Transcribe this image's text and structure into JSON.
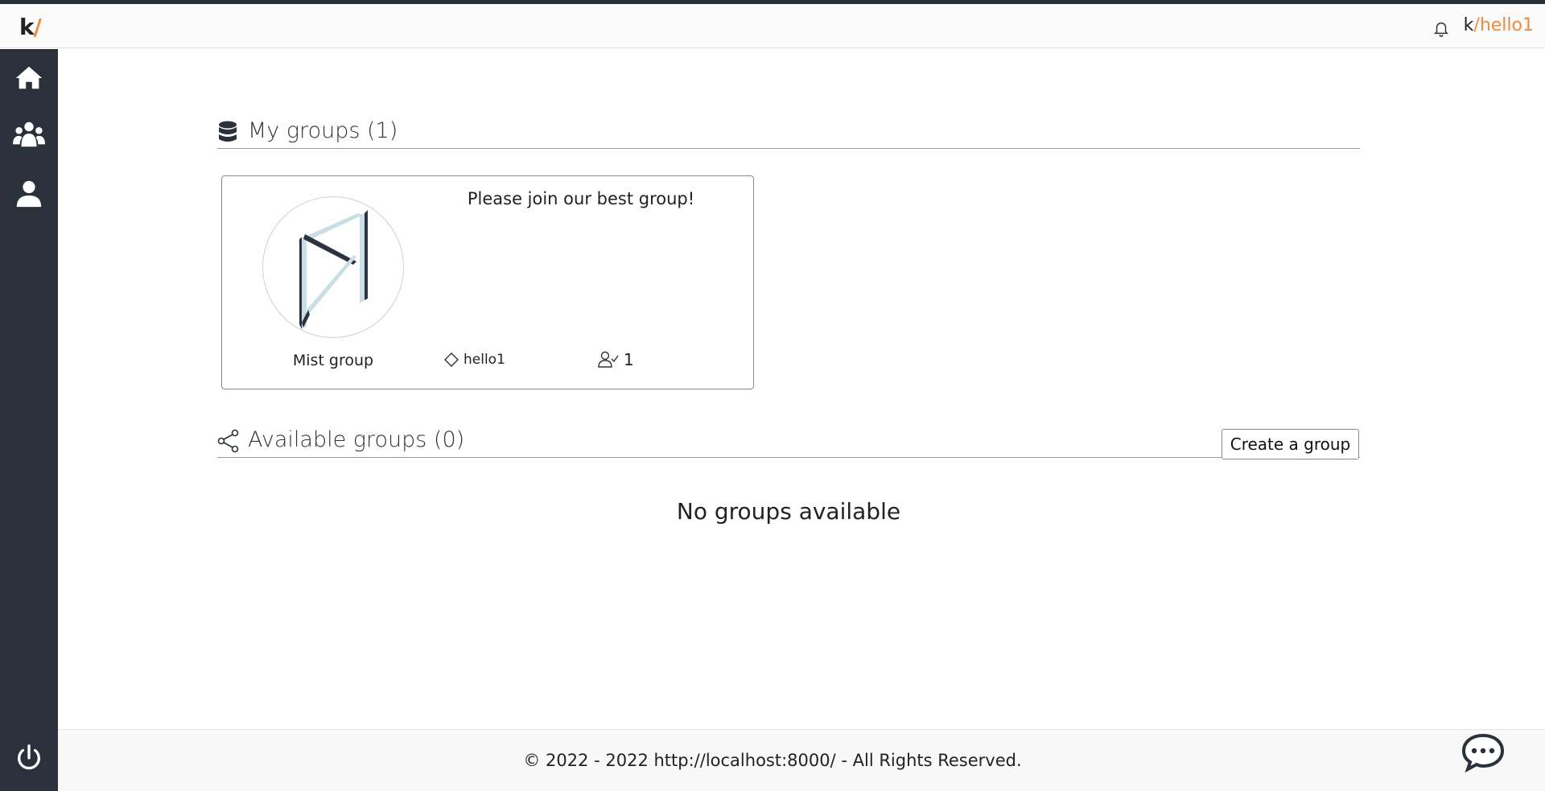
{
  "topbar": {
    "logo_k": "k",
    "logo_slash": "/",
    "user_k": "k",
    "user_slash": "/",
    "user_name": "hello1",
    "bell_icon": "bell-icon"
  },
  "sidebar": {
    "items": [
      {
        "icon": "home-icon"
      },
      {
        "icon": "groups-icon"
      },
      {
        "icon": "user-icon"
      },
      {
        "icon": "power-icon"
      }
    ]
  },
  "my_groups": {
    "title": "My groups (1)",
    "icon": "database-icon",
    "groups": [
      {
        "name": "Mist group",
        "description": "Please join our best group!",
        "owner": "hello1",
        "members": "1"
      }
    ]
  },
  "available_groups": {
    "title": "Available groups (0)",
    "icon": "share-icon",
    "create_label": "Create a group",
    "empty_message": "No groups available"
  },
  "footer": {
    "text": "© 2022 - 2022 http://localhost:8000/ - All Rights Reserved."
  },
  "colors": {
    "accent": "#f08a3c",
    "sidebar": "#2b313b"
  }
}
